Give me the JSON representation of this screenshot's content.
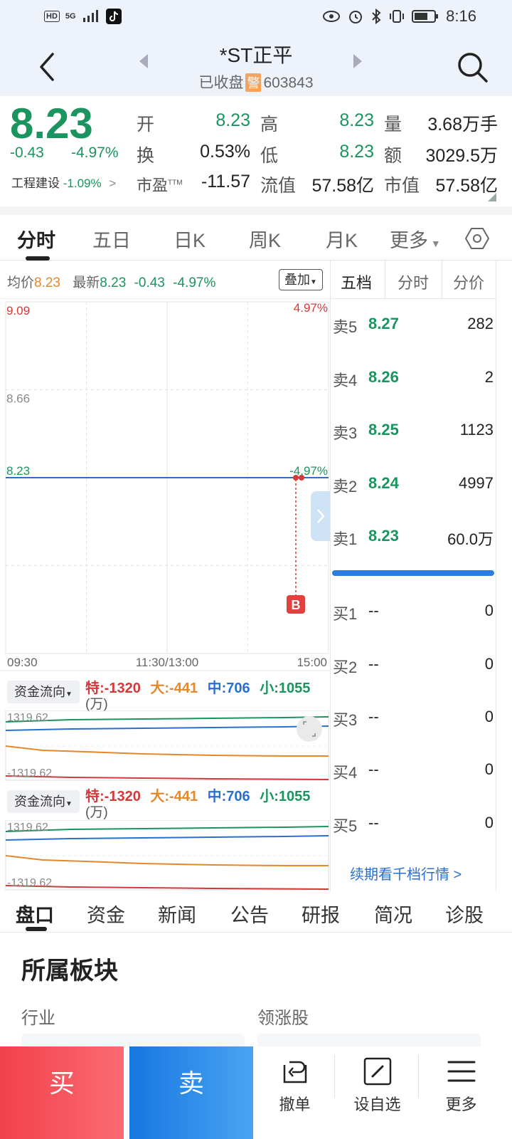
{
  "status_bar": {
    "hd": "HD",
    "net": "5G",
    "time": "8:16"
  },
  "header": {
    "stock_name": "*ST正平",
    "status": "已收盘",
    "warn_badge": "警",
    "code": "603843"
  },
  "quote": {
    "price": "8.23",
    "change": "-0.43",
    "change_pct": "-4.97%",
    "sector_name": "工程建设",
    "sector_pct": "-1.09%",
    "open_label": "开",
    "open_value": "8.23",
    "high_label": "高",
    "high_value": "8.23",
    "vol_label": "量",
    "vol_value": "3.68万手",
    "turnover_label": "换",
    "turnover_value": "0.53%",
    "low_label": "低",
    "low_value": "8.23",
    "amount_label": "额",
    "amount_value": "3029.5万",
    "pe_label": "市盈",
    "pe_sup": "TTM",
    "pe_value": "-11.57",
    "float_cap_label": "流值",
    "float_cap_value": "57.58亿",
    "mkt_cap_label": "市值",
    "mkt_cap_value": "57.58亿"
  },
  "tabs": [
    "分时",
    "五日",
    "日K",
    "周K",
    "月K",
    "更多"
  ],
  "chart_header": {
    "avg_label": "均价",
    "avg_value": "8.23",
    "latest_label": "最新",
    "latest_value": "8.23",
    "latest_chg": "-0.43",
    "latest_pct": "-4.97%",
    "overlay_label": "叠加"
  },
  "chart_data": {
    "type": "line",
    "title": "",
    "ylim": [
      7.37,
      9.09
    ],
    "y_tick_labels": [
      "9.09",
      "8.66",
      "8.23"
    ],
    "right_tick_labels": [
      "4.97%",
      "-4.97%"
    ],
    "x_tick_labels": [
      "09:30",
      "11:30/13:00",
      "15:00"
    ],
    "series": [
      {
        "values": [
          8.23,
          8.23
        ]
      }
    ],
    "marker": "B",
    "colors": {
      "line": "#2a6fd0",
      "grid": "#e3e3e3"
    }
  },
  "fund_flow": {
    "label": "资金流向",
    "te": "特:-1320",
    "da": "大:-441",
    "zhong": "中:706",
    "xiao": "小:1055",
    "unit": "(万)",
    "top_value": "1319.62",
    "bottom_value": "-1319.62"
  },
  "orderbook": {
    "tabs": [
      "五档",
      "分时",
      "分价"
    ],
    "sells": [
      {
        "label": "卖5",
        "price": "8.27",
        "vol": "282"
      },
      {
        "label": "卖4",
        "price": "8.26",
        "vol": "2"
      },
      {
        "label": "卖3",
        "price": "8.25",
        "vol": "1123"
      },
      {
        "label": "卖2",
        "price": "8.24",
        "vol": "4997"
      },
      {
        "label": "卖1",
        "price": "8.23",
        "vol": "60.0万"
      }
    ],
    "buys": [
      {
        "label": "买1",
        "price": "--",
        "vol": "0"
      },
      {
        "label": "买2",
        "price": "--",
        "vol": "0"
      },
      {
        "label": "买3",
        "price": "--",
        "vol": "0"
      },
      {
        "label": "买4",
        "price": "--",
        "vol": "0"
      },
      {
        "label": "买5",
        "price": "--",
        "vol": "0"
      }
    ],
    "link": "续期看千档行情 >"
  },
  "bottom_tabs": [
    "盘口",
    "资金",
    "新闻",
    "公告",
    "研报",
    "简况",
    "诊股"
  ],
  "section": {
    "title": "所属板块",
    "col_industry": "行业",
    "col_leader": "领涨股"
  },
  "bottom_bar": {
    "buy": "买",
    "sell": "卖",
    "cancel": "撤单",
    "watch": "设自选",
    "more": "更多"
  }
}
